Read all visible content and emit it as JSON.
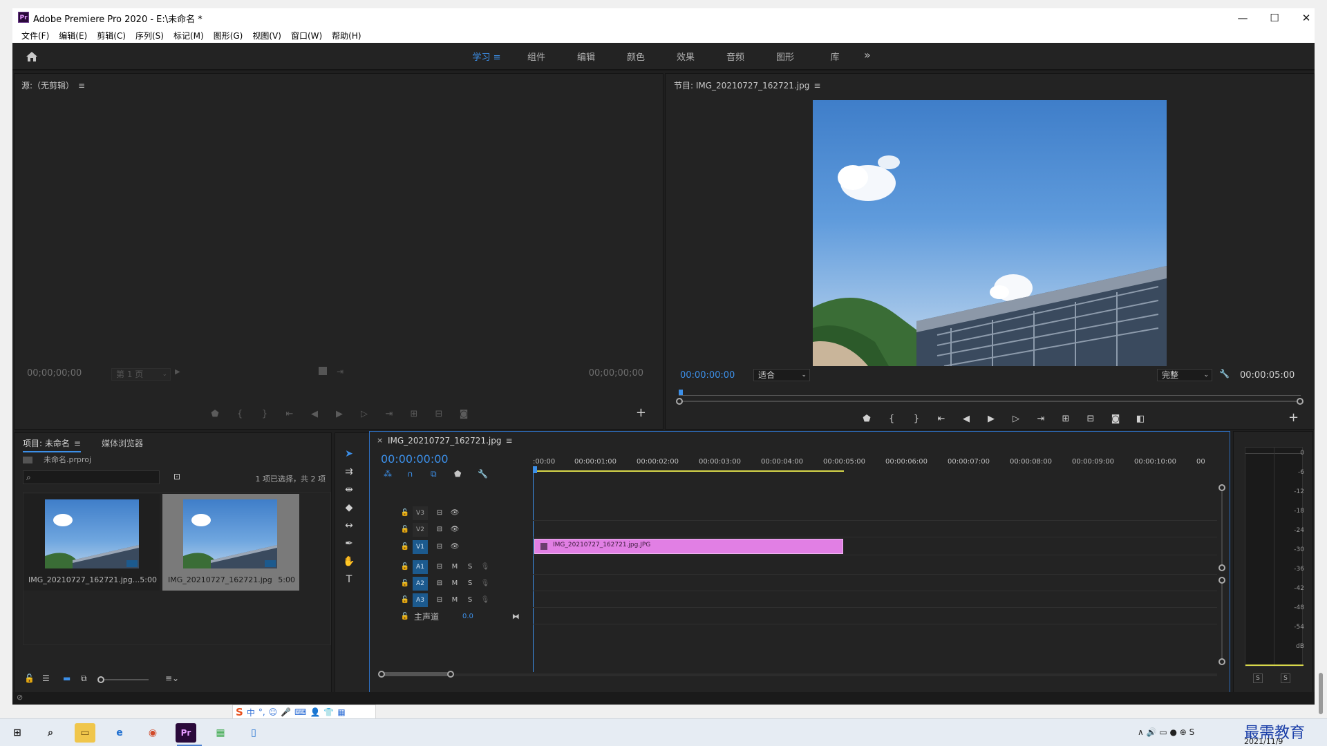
{
  "window": {
    "app_icon": "Pr",
    "title": "Adobe Premiere Pro 2020 - E:\\未命名 *",
    "minimize_glyph": "—",
    "maximize_glyph": "☐",
    "close_glyph": "✕"
  },
  "menu": [
    "文件(F)",
    "编辑(E)",
    "剪辑(C)",
    "序列(S)",
    "标记(M)",
    "图形(G)",
    "视图(V)",
    "窗口(W)",
    "帮助(H)"
  ],
  "workspaces": {
    "tabs": [
      "学习",
      "组件",
      "编辑",
      "颜色",
      "效果",
      "音频",
      "图形",
      "库"
    ],
    "active": "学习",
    "active_menu_glyph": "≡",
    "more_glyph": "»"
  },
  "source_monitor": {
    "title": "源:（无剪辑）",
    "timecode_left": "00;00;00;00",
    "page_dropdown": "第 1 页",
    "timecode_right": "00;00;00;00"
  },
  "program_monitor": {
    "title": "节目: IMG_20210727_162721.jpg",
    "timecode": "00:00:00:00",
    "fit_dropdown": "适合",
    "quality_dropdown": "完整",
    "duration": "00:00:05:00"
  },
  "project": {
    "tab_project": "项目: 未命名",
    "tab_media_browser": "媒体浏览器",
    "project_file": "未命名.prproj",
    "search_placeholder": "",
    "selection_status": "1 项已选择，共 2 项",
    "items": [
      {
        "name": "IMG_20210727_162721.jpg...",
        "duration": "5:00",
        "selected": false
      },
      {
        "name": "IMG_20210727_162721.jpg",
        "duration": "5:00",
        "selected": true
      }
    ]
  },
  "timeline": {
    "sequence_tab": "IMG_20210727_162721.jpg",
    "close_glyph": "×",
    "timecode": "00:00:00:00",
    "ruler": [
      ":00:00",
      "00:00:01:00",
      "00:00:02:00",
      "00:00:03:00",
      "00:00:04:00",
      "00:00:05:00",
      "00:00:06:00",
      "00:00:07:00",
      "00:00:08:00",
      "00:00:09:00",
      "00:00:10:00",
      "00"
    ],
    "video_tracks": [
      "V3",
      "V2",
      "V1"
    ],
    "audio_tracks": [
      "A1",
      "A2",
      "A3"
    ],
    "mute_label": "M",
    "solo_label": "S",
    "master_label": "主声道",
    "master_value": "0.0",
    "clip_name": "IMG_20210727_162721.jpg.JPG",
    "clip_color": "#e17fe4"
  },
  "audio_meter": {
    "scale": [
      "0",
      "-6",
      "-12",
      "-18",
      "-24",
      "-30",
      "-36",
      "-42",
      "-48",
      "-54",
      "dB"
    ],
    "solo_left": "S",
    "solo_right": "S"
  },
  "ime_toolbar": {
    "logo": "S",
    "items": [
      "中",
      "°,",
      "☺",
      "🎤",
      "⌨",
      "👤",
      "👕",
      "▦"
    ]
  },
  "taskbar": {
    "date": "2021/11/9",
    "watermark": "最需教育"
  },
  "colors": {
    "accent_blue": "#3c8fe8",
    "panel_bg": "#232323",
    "clip_pink": "#e17fe4",
    "timeline_work_area": "#d8d84a"
  }
}
